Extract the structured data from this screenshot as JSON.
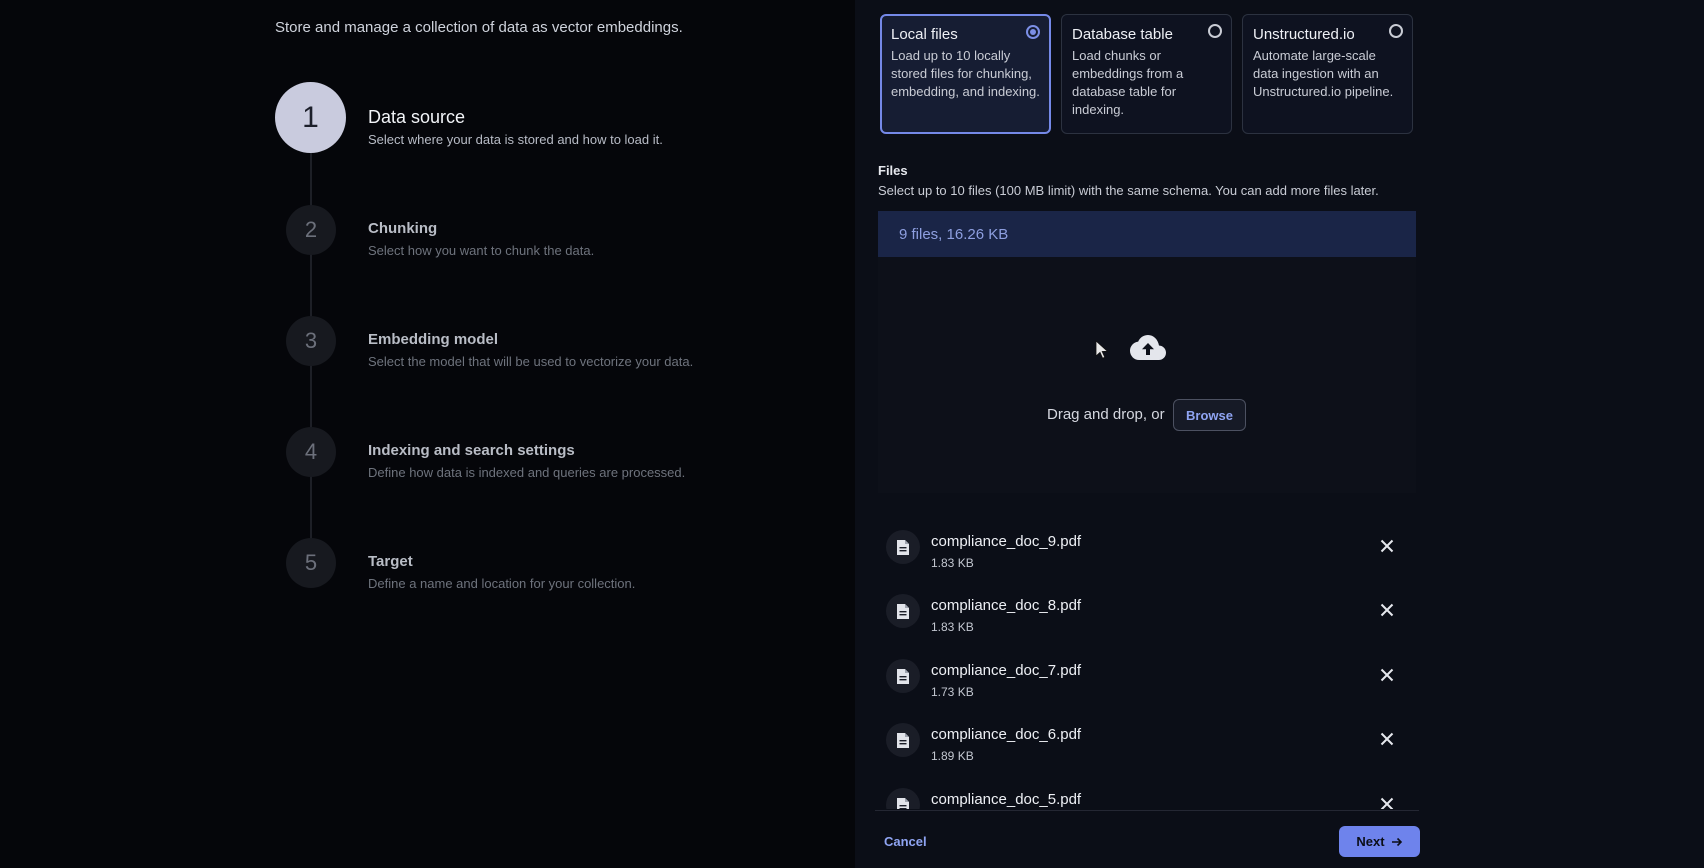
{
  "intro": "Store and manage a collection of data as vector embeddings.",
  "steps": [
    {
      "number": "1",
      "title": "Data source",
      "description": "Select where your data is stored and how to load it."
    },
    {
      "number": "2",
      "title": "Chunking",
      "description": "Select how you want to chunk the data."
    },
    {
      "number": "3",
      "title": "Embedding model",
      "description": "Select the model that will be used to vectorize your data."
    },
    {
      "number": "4",
      "title": "Indexing and search settings",
      "description": "Define how data is indexed and queries are processed."
    },
    {
      "number": "5",
      "title": "Target",
      "description": "Define a name and location for your collection."
    }
  ],
  "source_options": [
    {
      "title": "Local files",
      "description": "Load up to 10 locally stored files for chunking, embedding, and indexing.",
      "selected": true
    },
    {
      "title": "Database table",
      "description": "Load chunks or embeddings from a database table for indexing.",
      "selected": false
    },
    {
      "title": "Unstructured.io",
      "description": "Automate large-scale data ingestion with an Unstructured.io pipeline.",
      "selected": false
    }
  ],
  "files_section": {
    "label": "Files",
    "help": "Select up to 10 files (100 MB limit) with the same schema. You can add more files later.",
    "summary": "9 files, 16.26 KB"
  },
  "dropzone": {
    "text": "Drag and drop, or",
    "browse_label": "Browse",
    "icon": "cloud-upload-icon"
  },
  "files": [
    {
      "name": "compliance_doc_9.pdf",
      "size": "1.83 KB"
    },
    {
      "name": "compliance_doc_8.pdf",
      "size": "1.83 KB"
    },
    {
      "name": "compliance_doc_7.pdf",
      "size": "1.73 KB"
    },
    {
      "name": "compliance_doc_6.pdf",
      "size": "1.89 KB"
    },
    {
      "name": "compliance_doc_5.pdf",
      "size": ""
    }
  ],
  "footer": {
    "cancel_label": "Cancel",
    "next_label": "Next"
  },
  "colors": {
    "accent": "#6e83ec",
    "selected_border": "#7589e8",
    "summary_bg": "#1a2547",
    "background": "#05060a",
    "panel": "#0b0e17"
  }
}
